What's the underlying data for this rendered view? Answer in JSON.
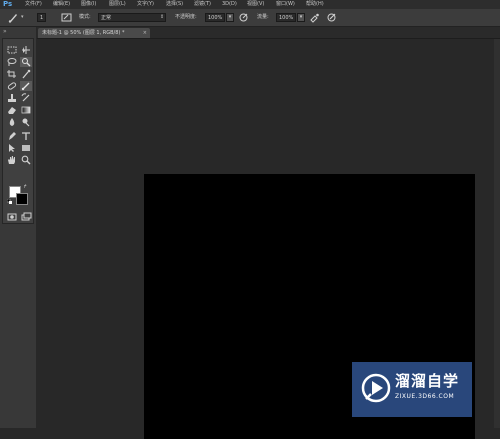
{
  "app": {
    "logo": "Ps"
  },
  "menu": [
    {
      "label": "文件(F)"
    },
    {
      "label": "编辑(E)"
    },
    {
      "label": "图像(I)"
    },
    {
      "label": "图层(L)"
    },
    {
      "label": "文字(Y)"
    },
    {
      "label": "选择(S)"
    },
    {
      "label": "滤镜(T)"
    },
    {
      "label": "3D(D)"
    },
    {
      "label": "视图(V)"
    },
    {
      "label": "窗口(W)"
    },
    {
      "label": "帮助(H)"
    }
  ],
  "options": {
    "brush_size": "1",
    "mode_label": "模式:",
    "mode_value": "正常",
    "opacity_label": "不透明度:",
    "opacity_value": "100%",
    "flow_label": "流量:",
    "flow_value": "100%"
  },
  "document": {
    "tab_label": "未标题-1 @ 50% (图层 1, RGB/8) *",
    "close_glyph": "×",
    "canvas_color": "#000000"
  },
  "toolbar": {
    "collapse_glyph": "»",
    "tools": [
      "rect-marquee-icon",
      "move-icon",
      "lasso-icon",
      "quick-select-icon",
      "crop-icon",
      "eyedropper-icon",
      "healing-brush-icon",
      "brush-icon",
      "clone-stamp-icon",
      "history-brush-icon",
      "eraser-icon",
      "gradient-icon",
      "blur-icon",
      "dodge-icon",
      "pen-icon",
      "type-icon",
      "path-select-icon",
      "shape-icon",
      "hand-icon",
      "zoom-icon"
    ],
    "foreground_color": "#ffffff",
    "background_color": "#000000"
  },
  "watermark": {
    "title": "溜溜自学",
    "url": "ZIXUE.3D66.COM"
  }
}
